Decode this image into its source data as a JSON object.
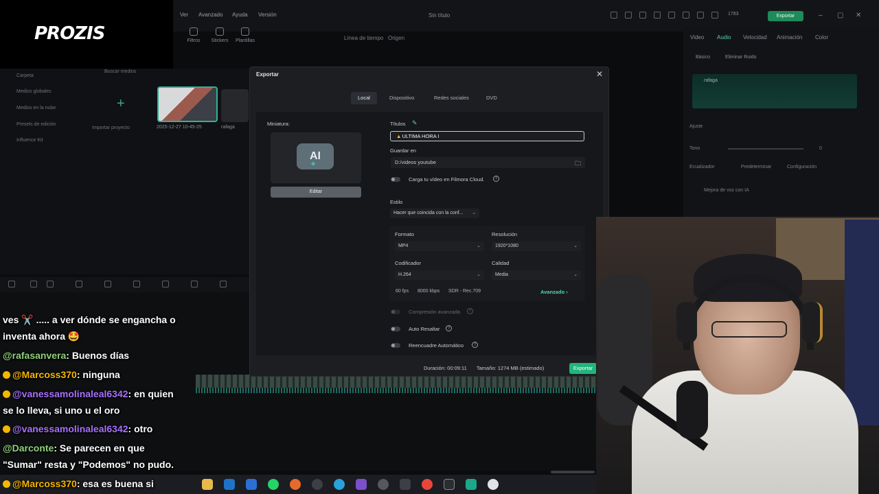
{
  "brand": {
    "logo_text": "PROZIS"
  },
  "topbar": {
    "menu": [
      "Ver",
      "Avanzado",
      "Ayuda",
      "Versión"
    ],
    "project_title": "Sin título",
    "credits": "1783",
    "export_label": "Exportar"
  },
  "toolbar": {
    "filters_label": "Filtros",
    "stickers_label": "Stickers",
    "templates_label": "Plantillas"
  },
  "preview_tabs": {
    "timeline": "Línea de tiempo",
    "source": "Origen"
  },
  "media": {
    "search_placeholder": "Buscar medios",
    "folders": [
      "Carpeta",
      "Medios globales",
      "Medios en la nube",
      "Presets de edición",
      "Influence Kit"
    ],
    "import_label": "Importar proyecto",
    "clip_name": "2025-12-27 10-45-25",
    "clip2_name": "rafaga"
  },
  "inspector": {
    "tabs": [
      "Video",
      "Audio",
      "Velocidad",
      "Animación",
      "Color"
    ],
    "subtabs": [
      "Básico",
      "Eliminar Ruido"
    ],
    "clip_name": "rafaga",
    "adjust_label": "Ajuste",
    "tone_label": "Tono",
    "tone_value": "0",
    "eq_label": "Ecualizador",
    "eq_value": "Predeterminar",
    "config_label": "Configuración",
    "voice_label": "Mejora de voz con IA"
  },
  "dialog": {
    "title": "Exportar",
    "tabs": [
      "Local",
      "Dispositivo",
      "Redes sociales",
      "DVD"
    ],
    "active_tab": "Local",
    "thumbnail_label": "Miniatura:",
    "thumbnail_ai": "AI",
    "edit_label": "Editar",
    "titles_label": "Títulos",
    "title_value": "ULTIMA HORA",
    "save_in_label": "Guardar en",
    "save_path": "D:/videos youtube",
    "cloud_label": "Carga tu vídeo en Filmora Cloud.",
    "style_label": "Estilo",
    "style_value": "Hacer que coincida con la conf...",
    "format_label": "Formato",
    "format_value": "MP4",
    "resolution_label": "Resolución",
    "resolution_value": "1920*1080",
    "encoder_label": "Codificador",
    "encoder_value": "H.264",
    "quality_label": "Calidad",
    "quality_value": "Media",
    "fps": "60 fps",
    "bitrate": "8000 kbps",
    "color": "SDR - Rec.709",
    "advanced_label": "Avanzado",
    "adv_compression_label": "Compresión avanzada",
    "auto_highlight_label": "Auto Resaltar",
    "auto_reframe_label": "Reencuadre Automático",
    "duration_text": "Duración: 00:09:11",
    "size_text": "Tamaño: 1274 MB",
    "estimated_text": "(estimado)",
    "export_button": "Exportar"
  },
  "chat": {
    "line1a": "ves ✂️ ..... a ver dónde se engancha o",
    "line1b": "inventa ahora 🤩",
    "m2_user": "@rafasanvera",
    "m2_text": ": Buenos días",
    "m3_user": "@Marcoss370",
    "m3_text": ": ninguna",
    "m4_user": "@vanessamolinaleal6342",
    "m4_text": ": en quien",
    "m4_text2": "se lo lleva, si uno u el oro",
    "m5_user": "@vanessamolinaleal6342",
    "m5_text": ": otro",
    "m6_user": "@Darconte",
    "m6_text": ": Se parecen en que",
    "m6_text2": "\"Sumar\" resta y \"Podemos\" no pudo.",
    "m7_user": "@Marcoss370",
    "m7_text": ": esa es buena si"
  }
}
